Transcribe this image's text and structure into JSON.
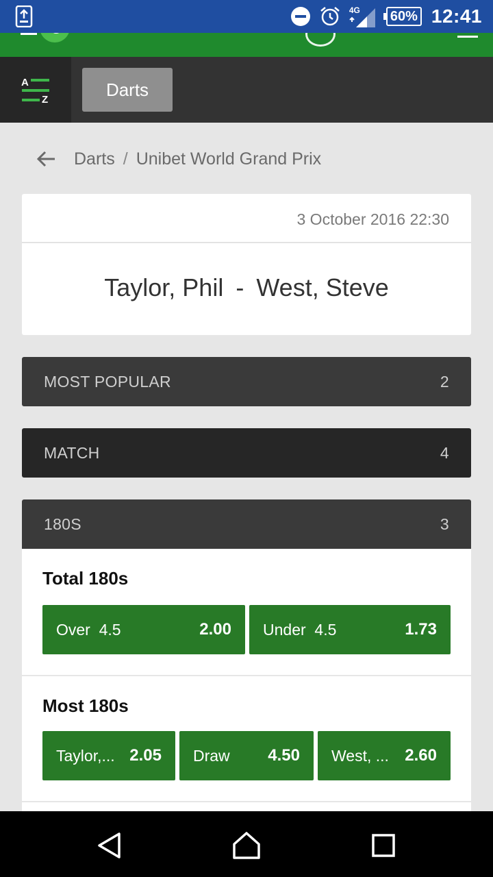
{
  "status_bar": {
    "battery": "60%",
    "time": "12:41",
    "network": "4G"
  },
  "nav": {
    "az_label_top": "A",
    "az_label_bottom": "Z",
    "tab_label": "Darts"
  },
  "breadcrumb": {
    "sport": "Darts",
    "separator": "/",
    "competition": "Unibet World Grand Prix"
  },
  "event": {
    "date": "3 October 2016 22:30",
    "home": "Taylor, Phil",
    "dash": "-",
    "away": "West, Steve"
  },
  "sections": [
    {
      "label": "MOST POPULAR",
      "count": "2"
    },
    {
      "label": "MATCH",
      "count": "4"
    },
    {
      "label": "180S",
      "count": "3"
    }
  ],
  "markets": [
    {
      "title": "Total 180s",
      "outcomes": [
        {
          "label": "Over  4.5",
          "price": "2.00"
        },
        {
          "label": "Under  4.5",
          "price": "1.73"
        }
      ]
    },
    {
      "title": "Most 180s",
      "outcomes": [
        {
          "label": "Taylor,...",
          "price": "2.05"
        },
        {
          "label": "Draw",
          "price": "4.50"
        },
        {
          "label": "West, ...",
          "price": "2.60"
        }
      ]
    }
  ],
  "colors": {
    "status_bar": "#1f4ea1",
    "brand_green": "#1f8a2d",
    "odds_green": "#287a27",
    "nav_dark": "#333333"
  }
}
